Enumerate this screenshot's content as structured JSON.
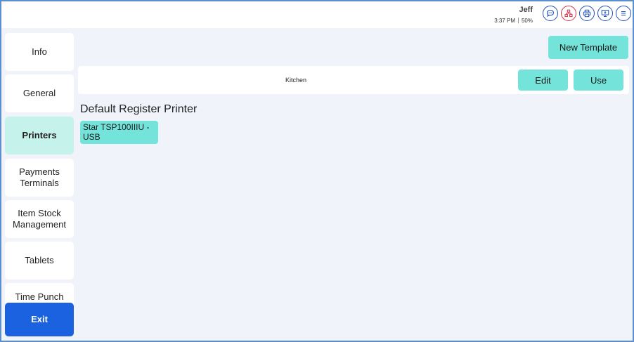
{
  "header": {
    "user_name": "Jeff",
    "time": "3:37 PM",
    "battery": "50%",
    "icons": [
      "chat-icon",
      "network-icon",
      "printer-icon",
      "display-icon",
      "menu-icon"
    ]
  },
  "sidebar": {
    "items": [
      {
        "label": "Info"
      },
      {
        "label": "General"
      },
      {
        "label": "Printers"
      },
      {
        "label": "Payments Terminals"
      },
      {
        "label": "Item Stock Management"
      },
      {
        "label": "Tablets"
      },
      {
        "label": "Time Punch"
      }
    ],
    "exit_label": "Exit"
  },
  "main": {
    "new_template_label": "New Template",
    "template": {
      "name": "Kitchen",
      "edit_label": "Edit",
      "use_label": "Use"
    },
    "section_title": "Default Register Printer",
    "printer_label": "Star TSP100IIIU - USB"
  },
  "colors": {
    "accent": "#74e3da",
    "active_bg": "#c5f3ec",
    "exit_bg": "#1a62e0",
    "icon_border": "#1f4fb8",
    "alert": "#d9304a"
  }
}
